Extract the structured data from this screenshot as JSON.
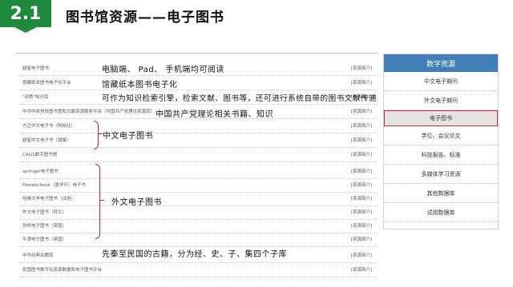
{
  "header": {
    "number": "2.1",
    "title": "图书馆资源——电子图书"
  },
  "list": {
    "rows": [
      {
        "name": "超星电子图书",
        "tag": "[资源简介]"
      },
      {
        "name": "馆藏纸本图书电子化平台",
        "tag": "[资源简介]"
      },
      {
        "name": "\"读秀\"知识库",
        "tag": "[资源简介]"
      },
      {
        "name": "中共中央党校图书馆和文献资源服务平台（中国共产党理论资源库）",
        "tag": "[资源简介]"
      },
      {
        "name": "方正中文电子书（阿帕比）",
        "tag": "[资源简介]"
      },
      {
        "name": "超星中文电子书（镜像）",
        "tag": "[资源简介]"
      },
      {
        "name": "CALIS数字图书馆",
        "tag": "[资源简介]"
      },
      {
        "name": "springer电子图书",
        "tag": "[资源简介]"
      },
      {
        "name": "Freeebchook（墨学乐）电子书",
        "tag": "[资源简介]"
      },
      {
        "name": "哈佛大学电子图书（试用）",
        "tag": "[资源简介]"
      },
      {
        "name": "外文电子图书（荷兰）",
        "tag": "[资源简介]"
      },
      {
        "name": "剑桥电子图书（英国）",
        "tag": "[资源简介]"
      },
      {
        "name": "牛津电子图书（英国）",
        "tag": "[资源简介]"
      },
      {
        "name": "中华经典古籍库",
        "tag": "[资源简介]"
      },
      {
        "name": "民国图书数字化资源数据库电子图书平台",
        "tag": "[资源简介]"
      }
    ]
  },
  "annotations": {
    "a1": "电脑端、 Pad、 手机端均可阅读",
    "a2": "馆藏纸本图书电子化",
    "a3": "可作为知识检索引擎，检索文献、图书等，还可进行系统自带的图书文献传递",
    "a4": "中国共产党理论相关书籍、知识",
    "a5": "中文电子图书",
    "a6": "外文电子图书",
    "a7": "先秦至民国的古籍，分为经、史、子、集四个子库"
  },
  "sidebar": {
    "header": "数字资源",
    "items": [
      {
        "label": "中文电子期刊"
      },
      {
        "label": "外文电子期刊"
      },
      {
        "label": "电子图书"
      },
      {
        "label": "学位、会议论文"
      },
      {
        "label": "科技报告、标准"
      },
      {
        "label": "多媒体学习资源"
      },
      {
        "label": "其他数据库"
      },
      {
        "label": "试用数据库"
      }
    ],
    "active_index": 2
  }
}
